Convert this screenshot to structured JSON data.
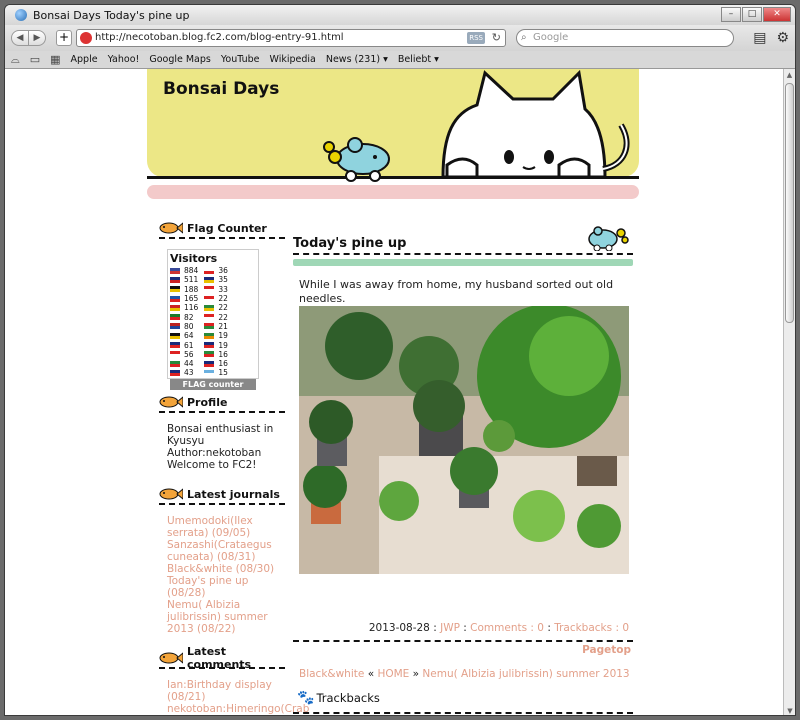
{
  "browser": {
    "window_title": "Bonsai Days Today's pine up",
    "url": "http://necotoban.blog.fc2.com/blog-entry-91.html",
    "rss": "RSS",
    "search_placeholder": "Google",
    "bookmarks": [
      "Apple",
      "Yahoo!",
      "Google Maps",
      "YouTube",
      "Wikipedia",
      "News (231) ▾",
      "Beliebt ▾"
    ]
  },
  "blog": {
    "title": "Bonsai Days",
    "sidebar": {
      "flag_counter_title": "Flag Counter",
      "visitors_label": "Visitors",
      "flags_left": [
        {
          "value": "884",
          "c1": "#3a4a9a",
          "c2": "#c33"
        },
        {
          "value": "511",
          "c1": "#1a2a7a",
          "c2": "#c22"
        },
        {
          "value": "188",
          "c1": "#111",
          "c2": "#e9c000"
        },
        {
          "value": "165",
          "c1": "#2255aa",
          "c2": "#d22"
        },
        {
          "value": "116",
          "c1": "#c22",
          "c2": "#e9c000"
        },
        {
          "value": "82",
          "c1": "#1a7a2a",
          "c2": "#d22"
        },
        {
          "value": "80",
          "c1": "#b22",
          "c2": "#224499"
        },
        {
          "value": "64",
          "c1": "#111",
          "c2": "#e9c000"
        },
        {
          "value": "61",
          "c1": "#1a2a7a",
          "c2": "#d22"
        },
        {
          "value": "56",
          "c1": "#d22",
          "c2": "#fff"
        },
        {
          "value": "44",
          "c1": "#2a8a3a",
          "c2": "#d22"
        },
        {
          "value": "43",
          "c1": "#1a2a7a",
          "c2": "#d22"
        }
      ],
      "flags_right": [
        {
          "value": "36",
          "c1": "#fff",
          "c2": "#d22"
        },
        {
          "value": "35",
          "c1": "#1a2a7a",
          "c2": "#e9c000"
        },
        {
          "value": "33",
          "c1": "#d22",
          "c2": "#fff"
        },
        {
          "value": "22",
          "c1": "#d22",
          "c2": "#fff"
        },
        {
          "value": "22",
          "c1": "#2a8a3a",
          "c2": "#e9c000"
        },
        {
          "value": "22",
          "c1": "#d22",
          "c2": "#fff"
        },
        {
          "value": "21",
          "c1": "#d22",
          "c2": "#2a8a3a"
        },
        {
          "value": "19",
          "c1": "#2a8a3a",
          "c2": "#e98a00"
        },
        {
          "value": "19",
          "c1": "#1a2a7a",
          "c2": "#d22"
        },
        {
          "value": "16",
          "c1": "#2a8a3a",
          "c2": "#d22"
        },
        {
          "value": "16",
          "c1": "#1a2a7a",
          "c2": "#d22"
        },
        {
          "value": "15",
          "c1": "#6ab0e0",
          "c2": "#fff"
        }
      ],
      "flag_footer": "FLAG counter",
      "profile_title": "Profile",
      "profile_lines": [
        "Bonsai enthusiast in Kyusyu",
        "Author:nekotoban",
        "Welcome to FC2!"
      ],
      "latest_journals_title": "Latest journals",
      "latest_journals": [
        "Umemodoki(Ilex serrata) (09/05)",
        "Sanzashi(Crataegus cuneata) (08/31)",
        "Black&white (08/30)",
        "Today's pine up (08/28)",
        "Nemu( Albizia julibrissin) summer 2013 (08/22)"
      ],
      "latest_comments_title": "Latest comments",
      "latest_comments": [
        "Ian:Birthday display (08/21)",
        "nekotoban:Himeringo(Crab apple/Malus×"
      ]
    },
    "post": {
      "title": "Today's pine up",
      "body": "While I was away from home, my husband sorted out old needles.",
      "date": "2013-08-28",
      "category": "JWP",
      "comments": "Comments : 0",
      "trackbacks": "Trackbacks : 0",
      "pagetop": "Pagetop",
      "prev": "Black&white",
      "home": "HOME",
      "next": "Nemu( Albizia julibrissin) summer 2013",
      "trackbacks_heading": "Trackbacks"
    }
  }
}
